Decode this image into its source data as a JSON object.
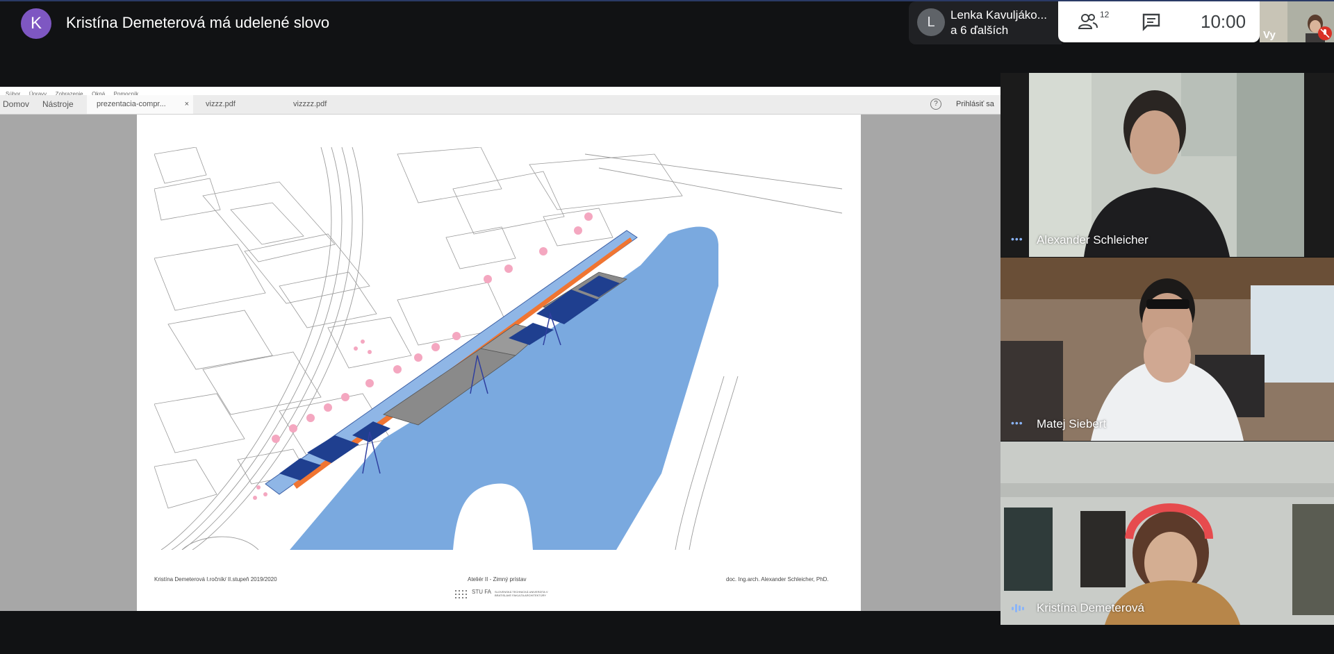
{
  "header": {
    "presenter_initial": "K",
    "presenter_title": "Kristína Demeterová má udelené slovo",
    "participants_line1": "Lenka Kavuljáko...",
    "participants_line2": "a 6 ďalších",
    "participants_initial": "L",
    "people_count": "12",
    "clock": "10:00",
    "self_label": "Vy"
  },
  "share": {
    "menu": [
      "Súbor",
      "Úpravy",
      "Zobrazenie",
      "Okná",
      "Pomocník"
    ],
    "toolbar": {
      "home": "Domov",
      "tools": "Nástroje"
    },
    "tabs": [
      "prezentacia-compr...",
      "vizzz.pdf",
      "vizzzz.pdf"
    ],
    "tab_close": "×",
    "help": "?",
    "signin": "Prihlásiť sa",
    "footer_left": "Kristína Demeterová   I.ročník/ II.stupeň    2019/2020",
    "footer_mid": "Ateliér II  -  Zimný prístav",
    "footer_right": "doc. Ing.arch. Alexander Schleicher, PhD.",
    "logo_text": "STU FA",
    "logo_sub": "SLOVENSKÁ TECHNICKÁ UNIVERZITA V BRATISLAVE FAKULTA ARCHITEKTÚRY"
  },
  "tiles": [
    {
      "name": "Alexander Schleicher"
    },
    {
      "name": "Matej Siebert"
    },
    {
      "name": "Kristína Demeterová"
    }
  ],
  "colors": {
    "accent": "#8ab4f8",
    "water": "#7aa9df",
    "mute": "#d93025",
    "avatar": "#7e57c2"
  }
}
